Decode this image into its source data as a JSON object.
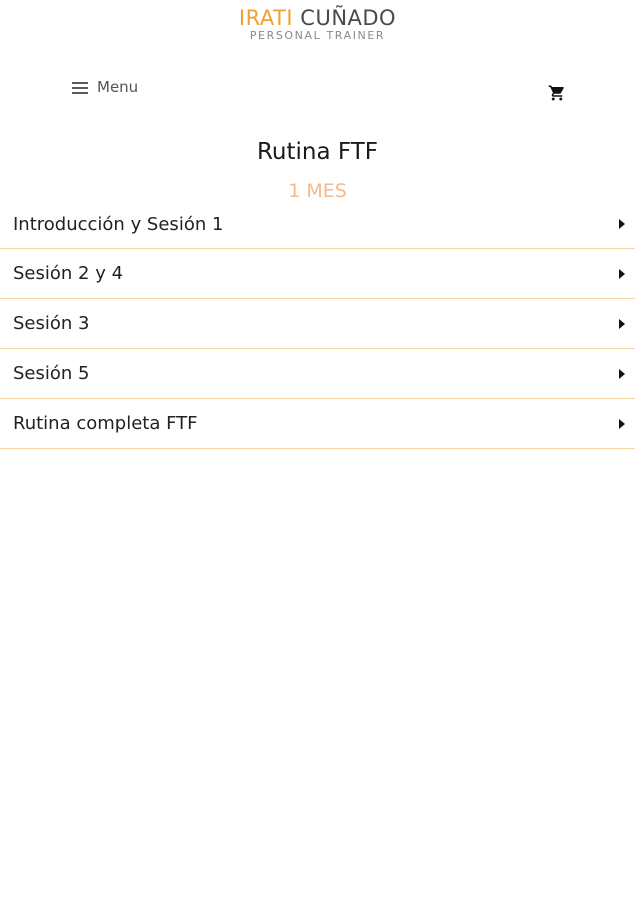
{
  "header": {
    "logo_first": "IRATI",
    "logo_last": "CUÑADO",
    "logo_tagline": "PERSONAL TRAINER",
    "menu_label": "Menu",
    "menu_icon": "hamburger-icon",
    "cart_icon": "cart-icon"
  },
  "main": {
    "title": "Rutina FTF",
    "subtitle": "1 MES",
    "items": [
      {
        "label": "Introducción y Sesión 1",
        "icon": "caret-right-icon"
      },
      {
        "label": "Sesión 2 y 4",
        "icon": "caret-right-icon"
      },
      {
        "label": "Sesión 3",
        "icon": "caret-right-icon"
      },
      {
        "label": "Sesión 5",
        "icon": "caret-right-icon"
      },
      {
        "label": "Rutina completa FTF",
        "icon": "caret-right-icon"
      }
    ]
  },
  "colors": {
    "brand_orange": "#f0a030",
    "subtitle_peach": "#f6b98a",
    "divider": "#f7d3a8",
    "text_dark": "#222222"
  }
}
